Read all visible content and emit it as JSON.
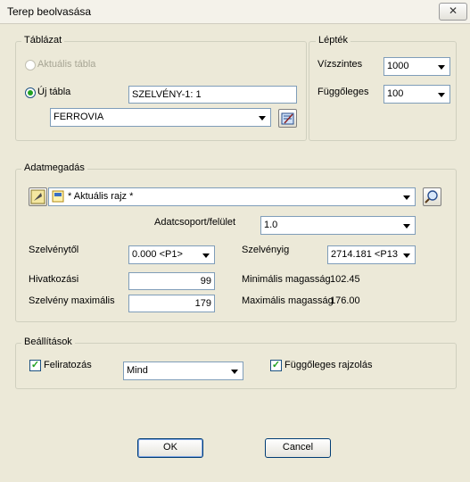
{
  "window": {
    "title": "Terep beolvasása",
    "close_glyph": "✕"
  },
  "tablazat": {
    "legend": "Táblázat",
    "aktualis_label": "Aktuális tábla",
    "uj_label": "Új tábla",
    "uj_value": "SZELVÉNY-1: 1",
    "style_select": "FERROVIA"
  },
  "leptek": {
    "legend": "Lépték",
    "vizszintes_label": "Vízszintes",
    "vizszintes_value": "1000",
    "fuggoleges_label": "Függőleges",
    "fuggoleges_value": "100"
  },
  "adat": {
    "legend": "Adatmegadás",
    "rajz_value": "* Aktuális rajz *",
    "csoport_label": "Adatcsoport/felület",
    "csoport_value": "1.0",
    "szelvenytol_label": "Szelvénytől",
    "szelvenytol_value": "0.000 <P1>",
    "szelvenyig_label": "Szelvényig",
    "szelvenyig_value": "2714.181 <P13",
    "hivatkozasi_label": "Hivatkozási",
    "hivatkozasi_value": "99",
    "szelveny_max_label": "Szelvény maximális",
    "szelveny_max_value": "179",
    "min_mag_label": "Minimális magasság",
    "min_mag_value": "102.45",
    "max_mag_label": "Maximális magasság",
    "max_mag_value": "176.00"
  },
  "beall": {
    "legend": "Beállítások",
    "feliratozas_label": "Feliratozás",
    "feliratozas_checked": true,
    "mind_value": "Mind",
    "fugg_rajz_label": "Függőleges rajzolás",
    "fugg_rajz_checked": true
  },
  "buttons": {
    "ok": "OK",
    "cancel": "Cancel"
  },
  "check_glyph": "✓"
}
